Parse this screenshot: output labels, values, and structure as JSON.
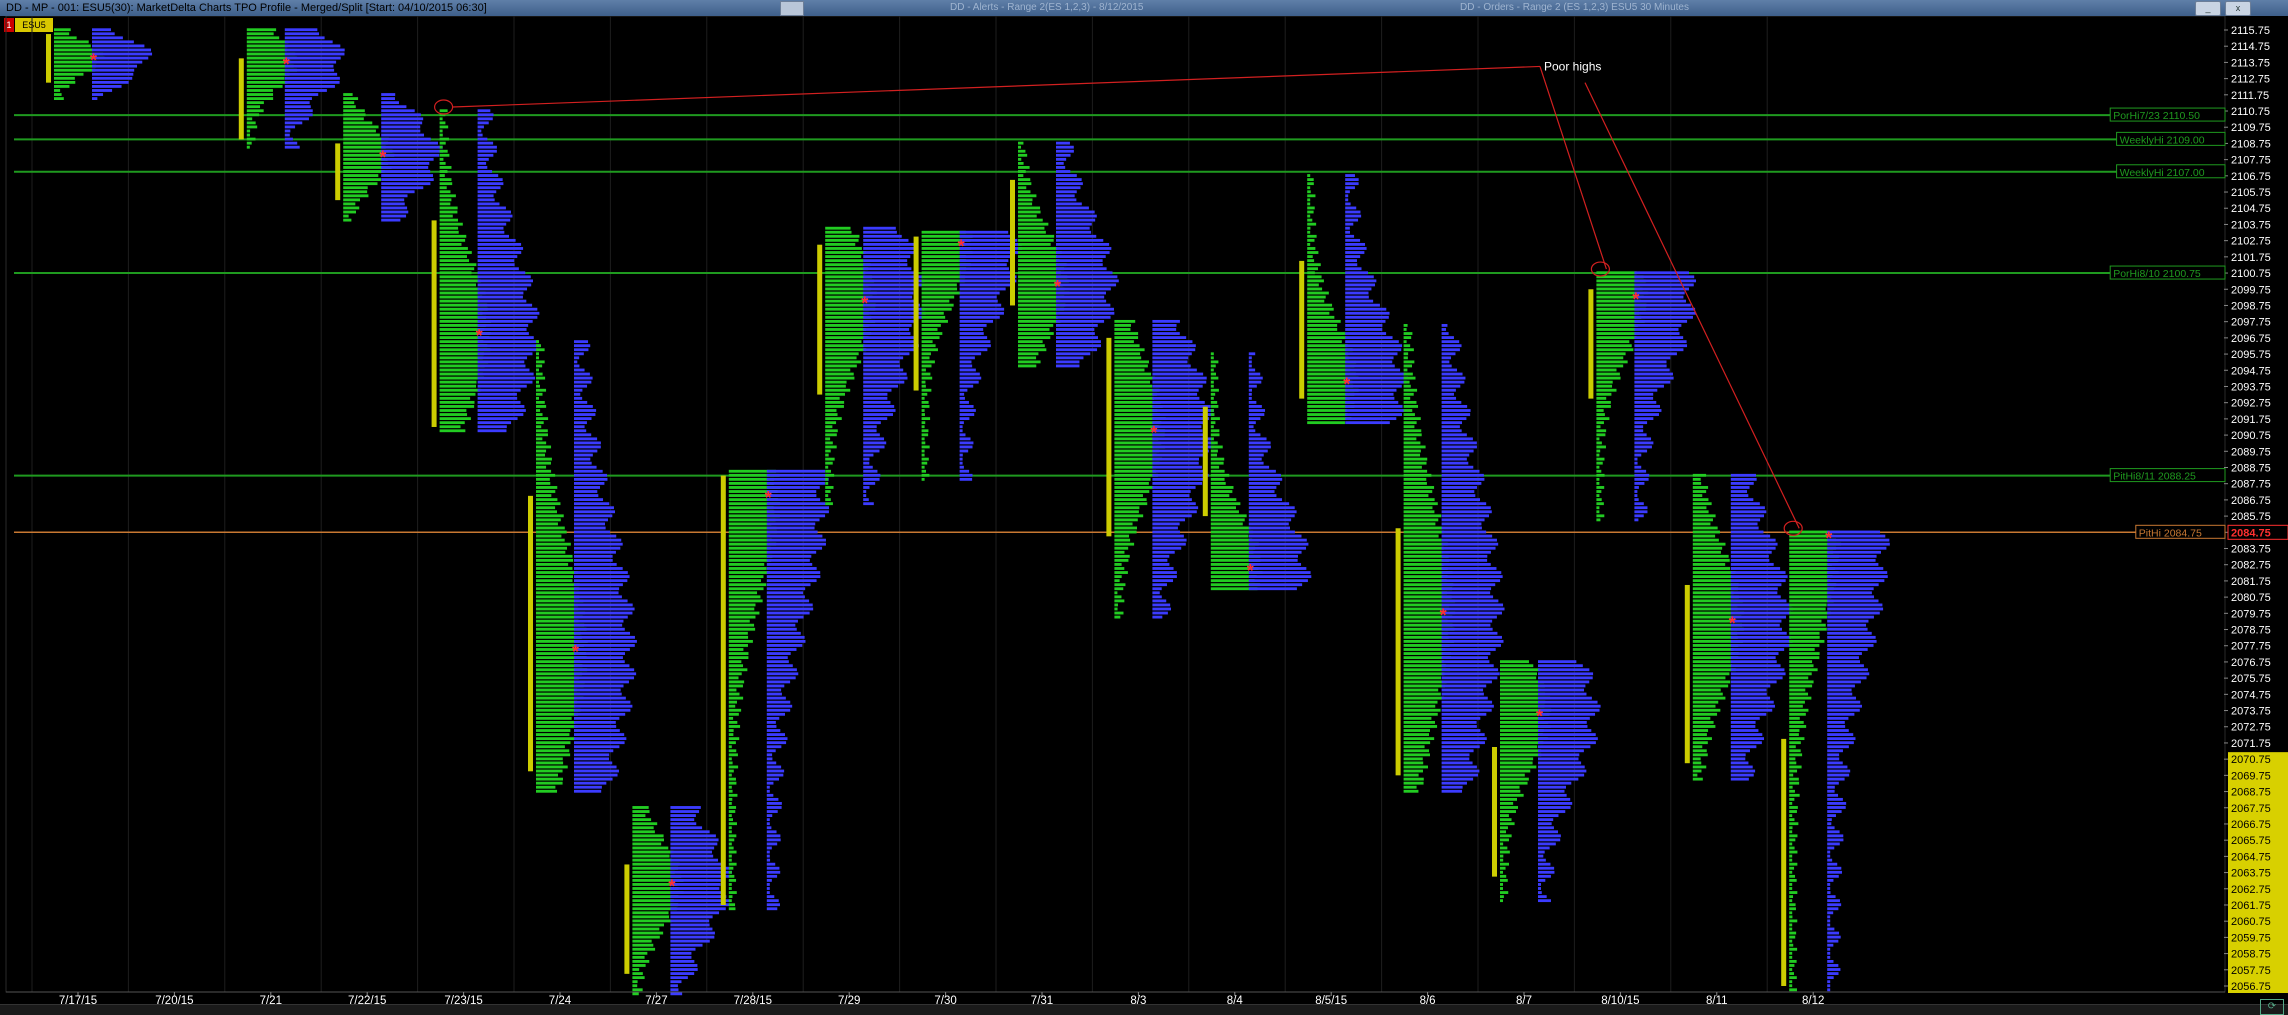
{
  "window": {
    "title": "DD - MP - 001: ESU5(30): MarketDelta Charts TPO Profile - Merged/Split [Start: 04/10/2015 06:30]",
    "right_title_1": "DD - Alerts - Range 2(ES 1,2,3) - 8/12/2015",
    "right_title_2": "DD - Orders - Range 2 (ES 1,2,3) ESU5 30 Minutes",
    "minimize_label": "_",
    "close_label": "x"
  },
  "symbol": {
    "number": "1",
    "name": "ESU5"
  },
  "colors": {
    "background": "#000000",
    "tpo": "#22cc22",
    "volume": "#3b3bff",
    "value_area_bar": "#cccc00",
    "poc_marker": "#ff3030",
    "reference_line": "#1f9a1f",
    "pit_high_line": "#c87832",
    "poor_highs_line": "#d22020",
    "axis_text": "#ffffff",
    "highlight_price_bg": "#d8d000"
  },
  "chart_data": {
    "type": "tpo-profile",
    "annotation": "Poor highs",
    "x_labels": [
      "7/17/15",
      "7/20/15",
      "7/21",
      "7/22/15",
      "7/23/15",
      "7/24",
      "7/27",
      "7/28/15",
      "7/29",
      "7/30",
      "7/31",
      "8/3",
      "8/4",
      "8/5/15",
      "8/6",
      "8/7",
      "8/10/15",
      "8/11",
      "8/12"
    ],
    "y_ticks": [
      "2115.75",
      "2114.75",
      "2113.75",
      "2112.75",
      "2111.75",
      "2110.75",
      "2109.75",
      "2108.75",
      "2107.75",
      "2106.75",
      "2105.75",
      "2104.75",
      "2103.75",
      "2102.75",
      "2101.75",
      "2100.75",
      "2099.75",
      "2098.75",
      "2097.75",
      "2096.75",
      "2095.75",
      "2094.75",
      "2093.75",
      "2092.75",
      "2091.75",
      "2090.75",
      "2089.75",
      "2088.75",
      "2087.75",
      "2086.75",
      "2085.75",
      "2084.75",
      "2083.75",
      "2082.75",
      "2081.75",
      "2080.75",
      "2079.75",
      "2078.75",
      "2077.75",
      "2076.75",
      "2075.75",
      "2074.75",
      "2073.75",
      "2072.75",
      "2071.75",
      "2070.75",
      "2069.75",
      "2068.75",
      "2067.75",
      "2066.75",
      "2065.75",
      "2064.75",
      "2063.75",
      "2062.75",
      "2061.75",
      "2060.75",
      "2059.75",
      "2058.75",
      "2057.75",
      "2056.75"
    ],
    "ylim": [
      2056.25,
      2116.25
    ],
    "highlighted_price_range": [
      2056.75,
      2070.75
    ],
    "reference_lines": [
      {
        "label": "PorHi7/23 2110.50",
        "price": 2110.5
      },
      {
        "label": "WeeklyHi 2109.00",
        "price": 2109.0
      },
      {
        "label": "WeeklyHi 2107.00",
        "price": 2107.0
      },
      {
        "label": "PorHi8/10 2100.75",
        "price": 2100.75
      },
      {
        "label": "PitHi8/11 2088.25",
        "price": 2088.25
      },
      {
        "label": "PitHi 2084.75",
        "price": 2084.75
      }
    ],
    "current_price_label": "2084.75",
    "poor_highs": [
      {
        "date": "7/23/15",
        "price": 2110.75
      },
      {
        "date": "8/10/15",
        "price": 2100.75
      },
      {
        "date": "8/12",
        "price": 2084.75
      }
    ],
    "profiles": [
      {
        "date": "7/17/15",
        "high": 2115.75,
        "low": 2111.5,
        "poc": 2114.0,
        "vah": 2115.5,
        "val": 2112.5
      },
      {
        "date": "7/21",
        "high": 2115.75,
        "low": 2108.5,
        "poc": 2113.75,
        "vah": 2114.0,
        "val": 2109.0
      },
      {
        "date": "7/22/15",
        "high": 2111.75,
        "low": 2104.0,
        "poc": 2108.0,
        "vah": 2108.75,
        "val": 2105.25
      },
      {
        "date": "7/23/15",
        "high": 2110.75,
        "low": 2091.0,
        "poc": 2097.0,
        "vah": 2104.0,
        "val": 2091.25
      },
      {
        "date": "7/24",
        "high": 2096.5,
        "low": 2068.75,
        "poc": 2077.5,
        "vah": 2087.0,
        "val": 2070.0
      },
      {
        "date": "7/27",
        "high": 2067.75,
        "low": 2056.25,
        "poc": 2063.0,
        "vah": 2064.25,
        "val": 2057.5
      },
      {
        "date": "7/28/15",
        "high": 2088.5,
        "low": 2061.5,
        "poc": 2087.0,
        "vah": 2088.25,
        "val": 2061.75
      },
      {
        "date": "7/29",
        "high": 2103.5,
        "low": 2086.5,
        "poc": 2099.0,
        "vah": 2102.5,
        "val": 2093.25
      },
      {
        "date": "7/30",
        "high": 2103.25,
        "low": 2088.0,
        "poc": 2102.5,
        "vah": 2103.0,
        "val": 2093.5
      },
      {
        "date": "7/31",
        "high": 2108.75,
        "low": 2095.0,
        "poc": 2100.0,
        "vah": 2106.5,
        "val": 2098.75
      },
      {
        "date": "8/3",
        "high": 2097.75,
        "low": 2079.5,
        "poc": 2091.0,
        "vah": 2096.75,
        "val": 2084.5
      },
      {
        "date": "8/4",
        "high": 2095.75,
        "low": 2081.25,
        "poc": 2082.5,
        "vah": 2092.5,
        "val": 2085.75
      },
      {
        "date": "8/5/15",
        "high": 2106.75,
        "low": 2091.5,
        "poc": 2094.0,
        "vah": 2101.5,
        "val": 2093.0
      },
      {
        "date": "8/6",
        "high": 2097.5,
        "low": 2068.75,
        "poc": 2079.75,
        "vah": 2085.0,
        "val": 2069.75
      },
      {
        "date": "8/7",
        "high": 2076.75,
        "low": 2062.0,
        "poc": 2073.5,
        "vah": 2071.5,
        "val": 2063.5
      },
      {
        "date": "8/10/15",
        "high": 2100.75,
        "low": 2085.5,
        "poc": 2099.25,
        "vah": 2099.75,
        "val": 2093.0
      },
      {
        "date": "8/11",
        "high": 2088.25,
        "low": 2069.5,
        "poc": 2079.25,
        "vah": 2081.5,
        "val": 2070.5
      },
      {
        "date": "8/12",
        "high": 2084.75,
        "low": 2056.5,
        "poc": 2084.5,
        "vah": 2072.0,
        "val": 2056.75
      }
    ]
  }
}
